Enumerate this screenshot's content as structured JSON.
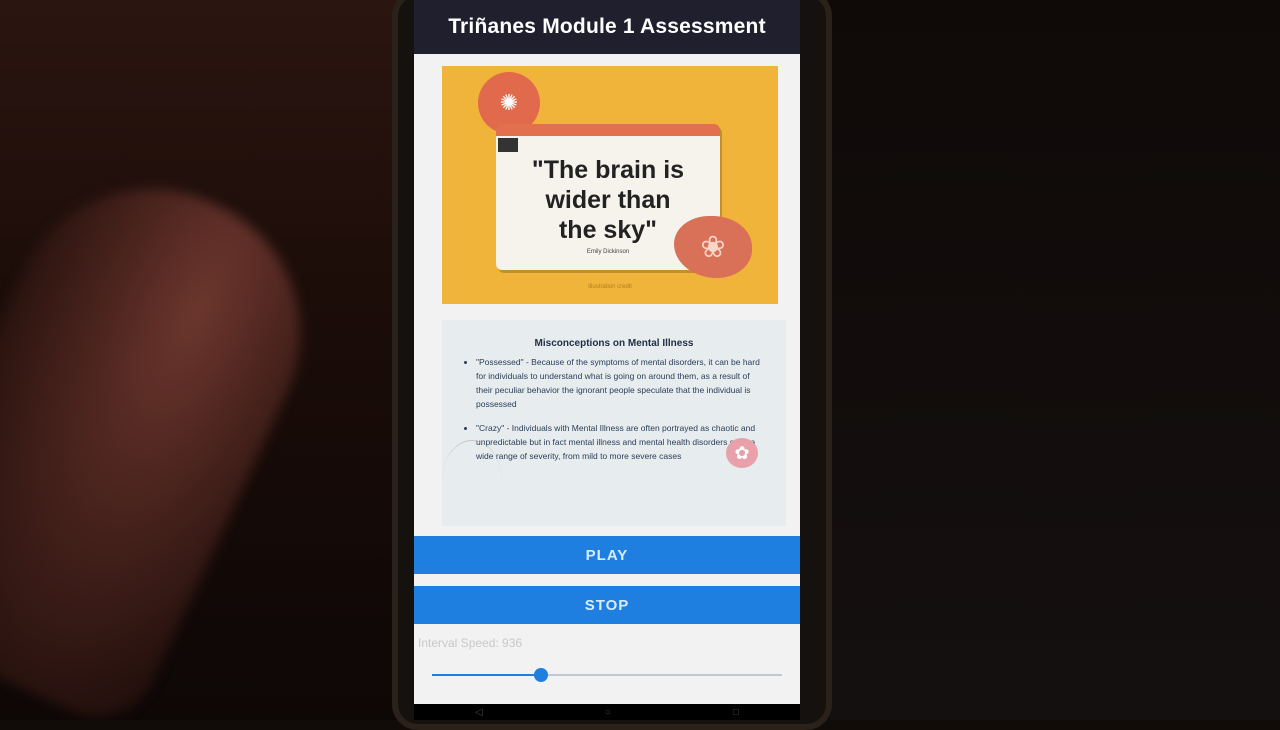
{
  "app": {
    "title": "Triñanes Module 1 Assessment"
  },
  "quote_card": {
    "quote": "\"The brain is\nwider than\nthe sky\"",
    "author": "Emily Dickinson",
    "footnote": "Illustration credit",
    "bulb_icon": "brain-bulb-icon",
    "brain_icon": "brain-icon"
  },
  "info_card": {
    "title": "Misconceptions on Mental Illness",
    "items": [
      "\"Possessed\" - Because of the symptoms of mental disorders, it can be hard for individuals to understand what is going on around them, as a result of their peculiar behavior the ignorant people speculate that the individual is possessed",
      "\"Crazy\" - Individuals with Mental Illness are often portrayed as chaotic and unpredictable but in fact mental illness and mental health disorders span a wide range of severity, from mild to more severe cases"
    ]
  },
  "controls": {
    "play_label": "PLAY",
    "stop_label": "STOP",
    "speed_label": "Interval Speed: 936",
    "speed_fraction": 0.31
  },
  "nav": {
    "back_icon": "◁",
    "home_icon": "○",
    "recent_icon": "□"
  },
  "colors": {
    "accent": "#1e7fe0",
    "appbar": "#1f1f2e",
    "quote_background": "#f0b43a"
  }
}
